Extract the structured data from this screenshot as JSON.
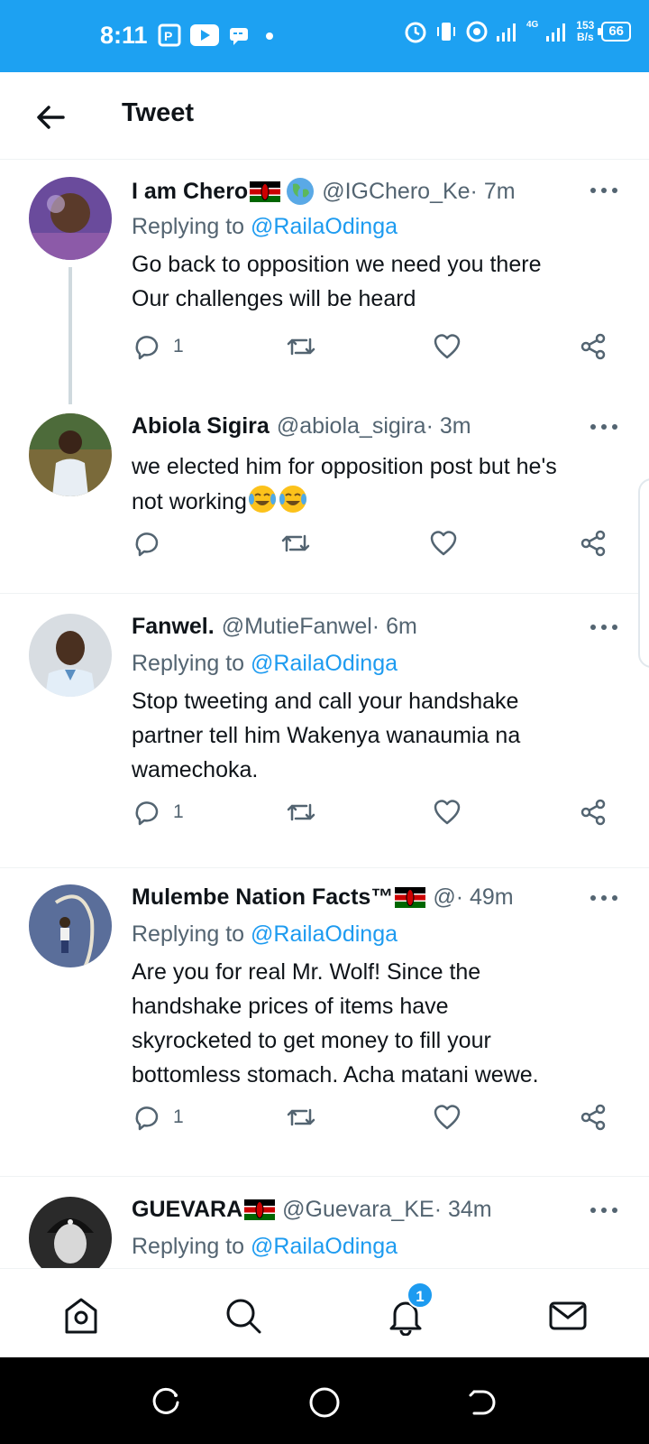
{
  "status_bar": {
    "time": "8:11",
    "network_badge": "4G",
    "speed_value": "153",
    "speed_unit": "B/s",
    "battery": "66"
  },
  "header": {
    "title": "Tweet"
  },
  "tweets": [
    {
      "name": "I am Chero",
      "handle": "@IGChero_Ke",
      "time": " · 7m",
      "replying_prefix": "Replying to ",
      "replying_to": "@RailaOdinga",
      "text_line1": "Go back to opposition we need you there",
      "text_line2": "Our challenges will be heard",
      "reply_count": "1"
    },
    {
      "name": "Abiola Sigira",
      "handle": "@abiola_sigira",
      "time": " · 3m",
      "text_line1": "we elected him for opposition post but he's",
      "text_line2": "not working",
      "reply_count": ""
    },
    {
      "name": "Fanwel.",
      "handle": "@MutieFanwel",
      "time": " · 6m",
      "replying_prefix": "Replying to ",
      "replying_to": "@RailaOdinga",
      "text_line1": "Stop tweeting and call your handshake",
      "text_line2": "partner tell him Wakenya wanaumia na",
      "text_line3": "wamechoka.",
      "reply_count": "1"
    },
    {
      "name": "Mulembe Nation Facts™",
      "handle": "@",
      "time": " · 49m",
      "replying_prefix": "Replying to ",
      "replying_to": "@RailaOdinga",
      "text_line1": "Are you for real Mr. Wolf! Since the",
      "text_line2": "handshake prices of items have",
      "text_line3": "skyrocketed to get money to fill your",
      "text_line4": "bottomless stomach. Acha matani wewe.",
      "reply_count": "1"
    },
    {
      "name": "GUEVARA",
      "handle": "@Guevara_KE",
      "time": " · 34m",
      "replying_prefix": "Replying to ",
      "replying_to": "@RailaOdinga"
    }
  ],
  "bottom_nav": {
    "notification_count": "1"
  },
  "colors": {
    "accent": "#1d9bf0",
    "status_bar": "#1da1f2",
    "secondary_text": "#536471"
  }
}
